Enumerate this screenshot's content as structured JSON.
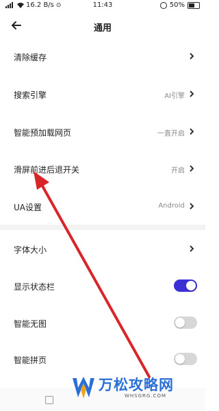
{
  "status_bar": {
    "left_text": "16.2 B/s",
    "time": "11:43",
    "battery_text": "50%"
  },
  "header": {
    "title": "通用",
    "back_icon": "arrow-left-icon"
  },
  "settings": {
    "clear_cache": {
      "label": "清除缓存"
    },
    "search_engine": {
      "label": "搜索引擎",
      "value": "AI引擎"
    },
    "preload": {
      "label": "智能预加载网页",
      "value": "一直开启"
    },
    "swipe_nav": {
      "label": "滑屏前进后退开关",
      "value": "开启"
    },
    "ua": {
      "label": "UA设置",
      "value": "Android"
    },
    "font_size": {
      "label": "字体大小"
    },
    "show_statusbar": {
      "label": "显示状态栏",
      "on": true
    },
    "smart_no_image": {
      "label": "智能无图",
      "on": false
    },
    "smart_page_join": {
      "label": "智能拼页",
      "on": false
    }
  },
  "watermark": {
    "brand": "万松攻略网",
    "domain": "WHSGRG.COM",
    "brand_color": "#2a6fd6"
  },
  "annotation": {
    "arrow_color": "#d9252a"
  }
}
